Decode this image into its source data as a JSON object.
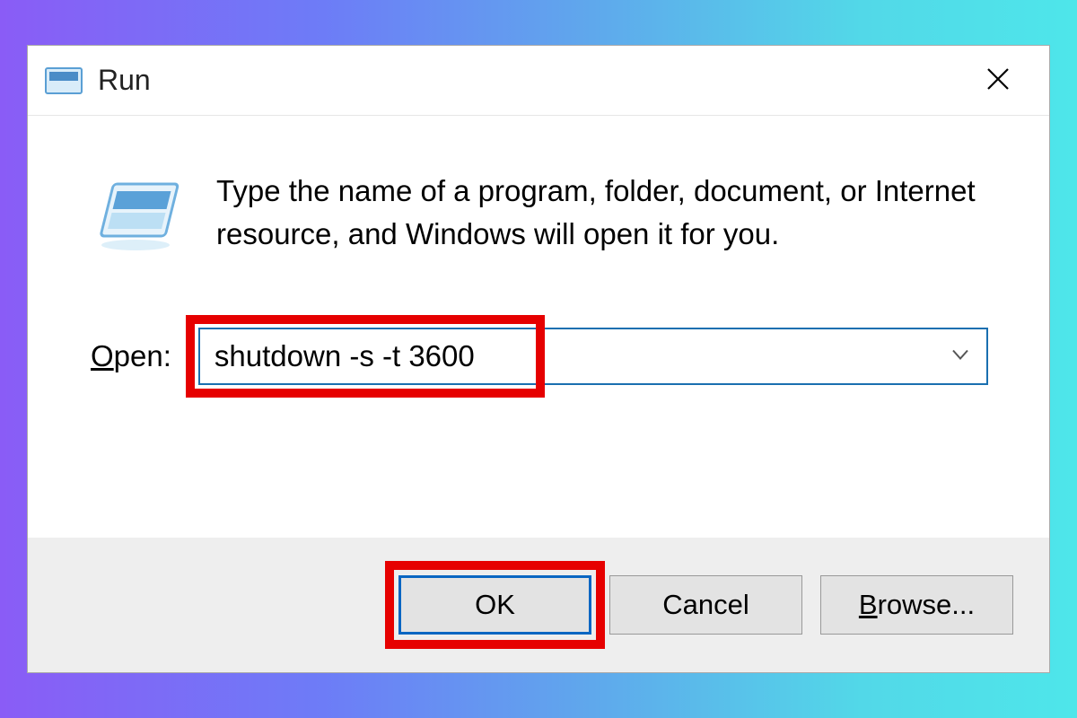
{
  "dialog": {
    "title": "Run",
    "description": "Type the name of a program, folder, document, or Internet resource, and Windows will open it for you.",
    "open_label_prefix": "O",
    "open_label_rest": "pen:",
    "input_value": "shutdown -s -t 3600",
    "buttons": {
      "ok": "OK",
      "cancel": "Cancel",
      "browse_prefix": "B",
      "browse_rest": "rowse..."
    }
  }
}
